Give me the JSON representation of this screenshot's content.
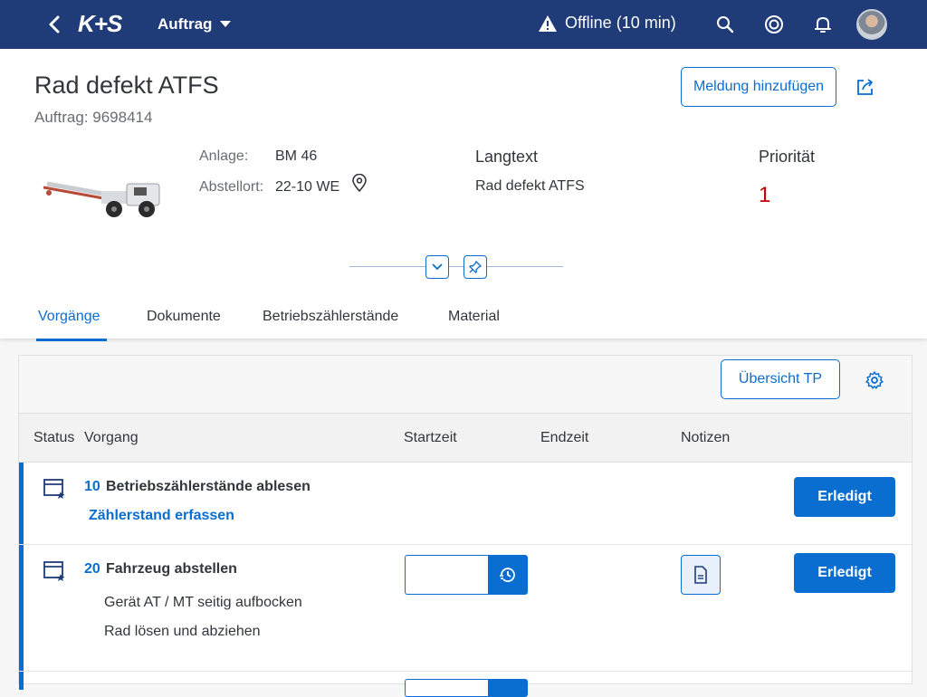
{
  "shell": {
    "logo": "K+S",
    "app_title": "Auftrag",
    "offline_status": "Offline (10 min)",
    "icons": [
      "back-icon",
      "warning-icon",
      "search-icon",
      "copilot-icon",
      "bell-icon",
      "avatar"
    ]
  },
  "header": {
    "title": "Rad defekt ATFS",
    "subtitle": "Auftrag: 9698414",
    "add_notification_label": "Meldung hinzufügen",
    "anlage_label": "Anlage:",
    "anlage_value": "BM 46",
    "abstellort_label": "Abstellort:",
    "abstellort_value": "22-10 WE",
    "langtext_title": "Langtext",
    "langtext_value": "Rad defekt ATFS",
    "prioritaet_title": "Priorität",
    "prioritaet_value": "1"
  },
  "tabs": [
    {
      "label": "Vorgänge",
      "active": true
    },
    {
      "label": "Dokumente",
      "active": false
    },
    {
      "label": "Betriebszählerstände",
      "active": false
    },
    {
      "label": "Material",
      "active": false
    }
  ],
  "table": {
    "overview_button": "Übersicht TP",
    "columns": {
      "status": "Status",
      "vorgang": "Vorgang",
      "startzeit": "Startzeit",
      "endzeit": "Endzeit",
      "notizen": "Notizen"
    },
    "rows": [
      {
        "number": "10",
        "text": "Betriebszählerstände ablesen",
        "link": "Zählerstand erfassen",
        "action": "Erledigt"
      },
      {
        "number": "20",
        "text": "Fahrzeug abstellen",
        "details": [
          "Gerät AT / MT seitig aufbocken",
          "Rad lösen und abziehen"
        ],
        "action": "Erledigt"
      }
    ]
  },
  "colors": {
    "shell": "#1f3b78",
    "accent": "#0a6ed1",
    "priority": "#bb0000"
  }
}
